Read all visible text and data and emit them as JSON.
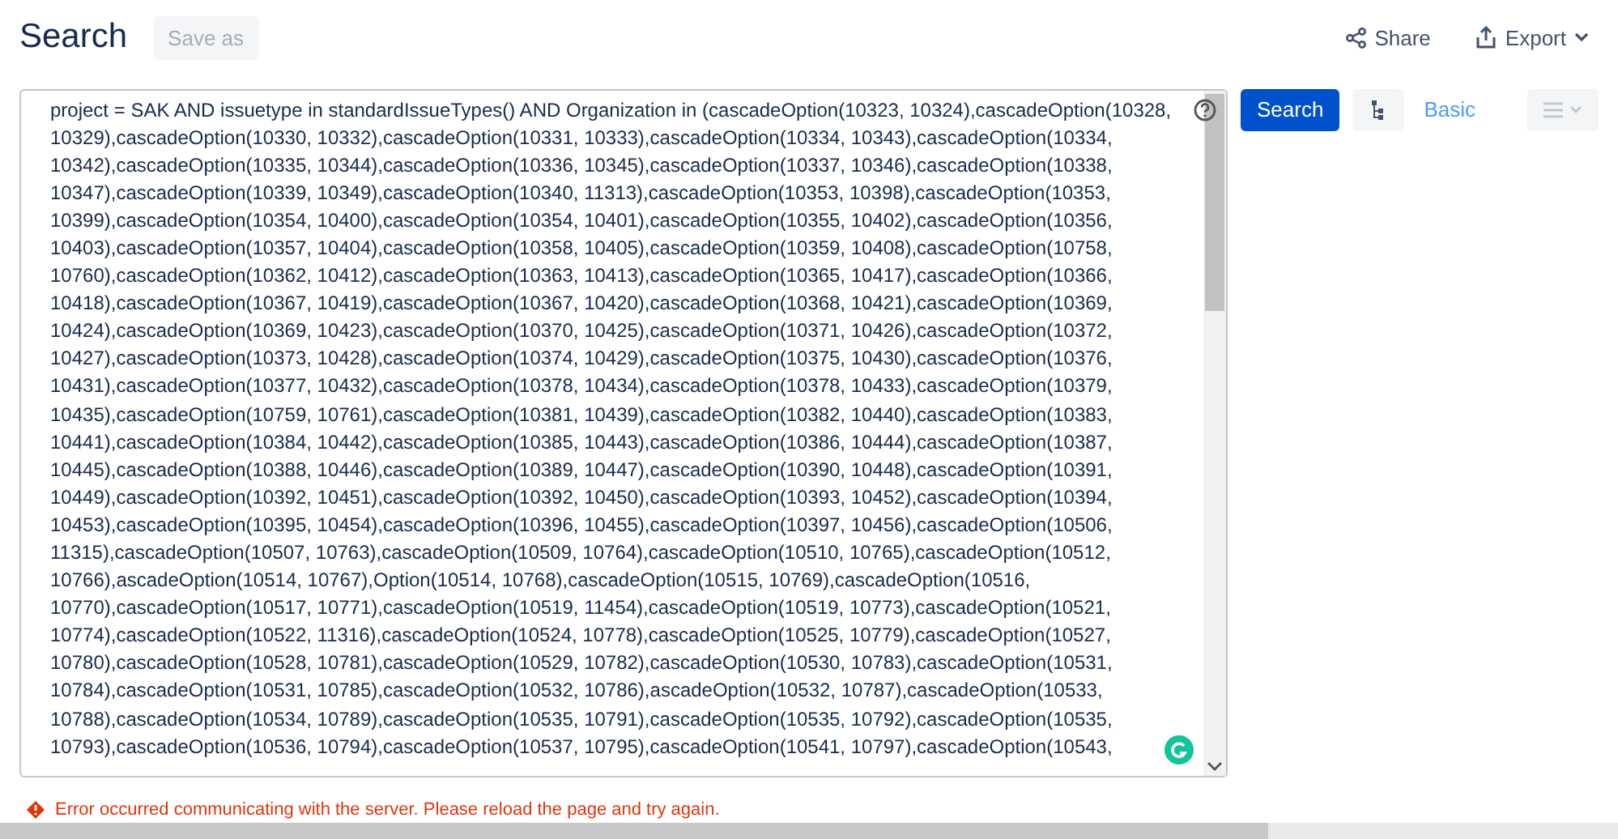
{
  "header": {
    "title": "Search",
    "save_as": {
      "label": "Save as",
      "disabled": true
    },
    "actions": [
      {
        "label": "Share",
        "kind": "share"
      },
      {
        "label": "Export",
        "kind": "export"
      }
    ]
  },
  "query": {
    "lines": [
      "project = SAK AND issuetype in standardIssueTypes() AND Organization in (cascadeOption(10323, 10324),cascadeOption(10328,",
      "10329),cascadeOption(10330, 10332),cascadeOption(10331, 10333),cascadeOption(10334, 10343),cascadeOption(10334,",
      "10342),cascadeOption(10335, 10344),cascadeOption(10336, 10345),cascadeOption(10337, 10346),cascadeOption(10338,",
      "10347),cascadeOption(10339, 10349),cascadeOption(10340, 11313),cascadeOption(10353, 10398),cascadeOption(10353,",
      "10399),cascadeOption(10354, 10400),cascadeOption(10354, 10401),cascadeOption(10355, 10402),cascadeOption(10356,",
      "10403),cascadeOption(10357, 10404),cascadeOption(10358, 10405),cascadeOption(10359, 10408),cascadeOption(10758,",
      "10760),cascadeOption(10362, 10412),cascadeOption(10363, 10413),cascadeOption(10365, 10417),cascadeOption(10366,",
      "10418),cascadeOption(10367, 10419),cascadeOption(10367, 10420),cascadeOption(10368, 10421),cascadeOption(10369,",
      "10424),cascadeOption(10369, 10423),cascadeOption(10370, 10425),cascadeOption(10371, 10426),cascadeOption(10372,",
      "10427),cascadeOption(10373, 10428),cascadeOption(10374, 10429),cascadeOption(10375, 10430),cascadeOption(10376,",
      "10431),cascadeOption(10377, 10432),cascadeOption(10378, 10434),cascadeOption(10378, 10433),cascadeOption(10379,",
      "10435),cascadeOption(10759, 10761),cascadeOption(10381, 10439),cascadeOption(10382, 10440),cascadeOption(10383,",
      "10441),cascadeOption(10384, 10442),cascadeOption(10385, 10443),cascadeOption(10386, 10444),cascadeOption(10387,",
      "10445),cascadeOption(10388, 10446),cascadeOption(10389, 10447),cascadeOption(10390, 10448),cascadeOption(10391,",
      "10449),cascadeOption(10392, 10451),cascadeOption(10392, 10450),cascadeOption(10393, 10452),cascadeOption(10394,",
      "10453),cascadeOption(10395, 10454),cascadeOption(10396, 10455),cascadeOption(10397, 10456),cascadeOption(10506,",
      "11315),cascadeOption(10507, 10763),cascadeOption(10509, 10764),cascadeOption(10510, 10765),cascadeOption(10512,",
      "10766),ascadeOption(10514, 10767),Option(10514, 10768),cascadeOption(10515, 10769),cascadeOption(10516,",
      "10770),cascadeOption(10517, 10771),cascadeOption(10519, 11454),cascadeOption(10519, 10773),cascadeOption(10521,",
      "10774),cascadeOption(10522, 11316),cascadeOption(10524, 10778),cascadeOption(10525, 10779),cascadeOption(10527,",
      "10780),cascadeOption(10528, 10781),cascadeOption(10529, 10782),cascadeOption(10530, 10783),cascadeOption(10531,",
      "10784),cascadeOption(10531, 10785),cascadeOption(10532, 10786),ascadeOption(10532, 10787),cascadeOption(10533,",
      "10788),cascadeOption(10534, 10789),cascadeOption(10535, 10791),cascadeOption(10535, 10792),cascadeOption(10535,",
      "10793),cascadeOption(10536, 10794),cascadeOption(10537, 10795),cascadeOption(10541, 10797),cascadeOption(10543,"
    ]
  },
  "controls": {
    "search": "Search",
    "basic": "Basic",
    "menu_disabled": true
  },
  "error": "Error occurred communicating with the server. Please reload the page and try again."
}
